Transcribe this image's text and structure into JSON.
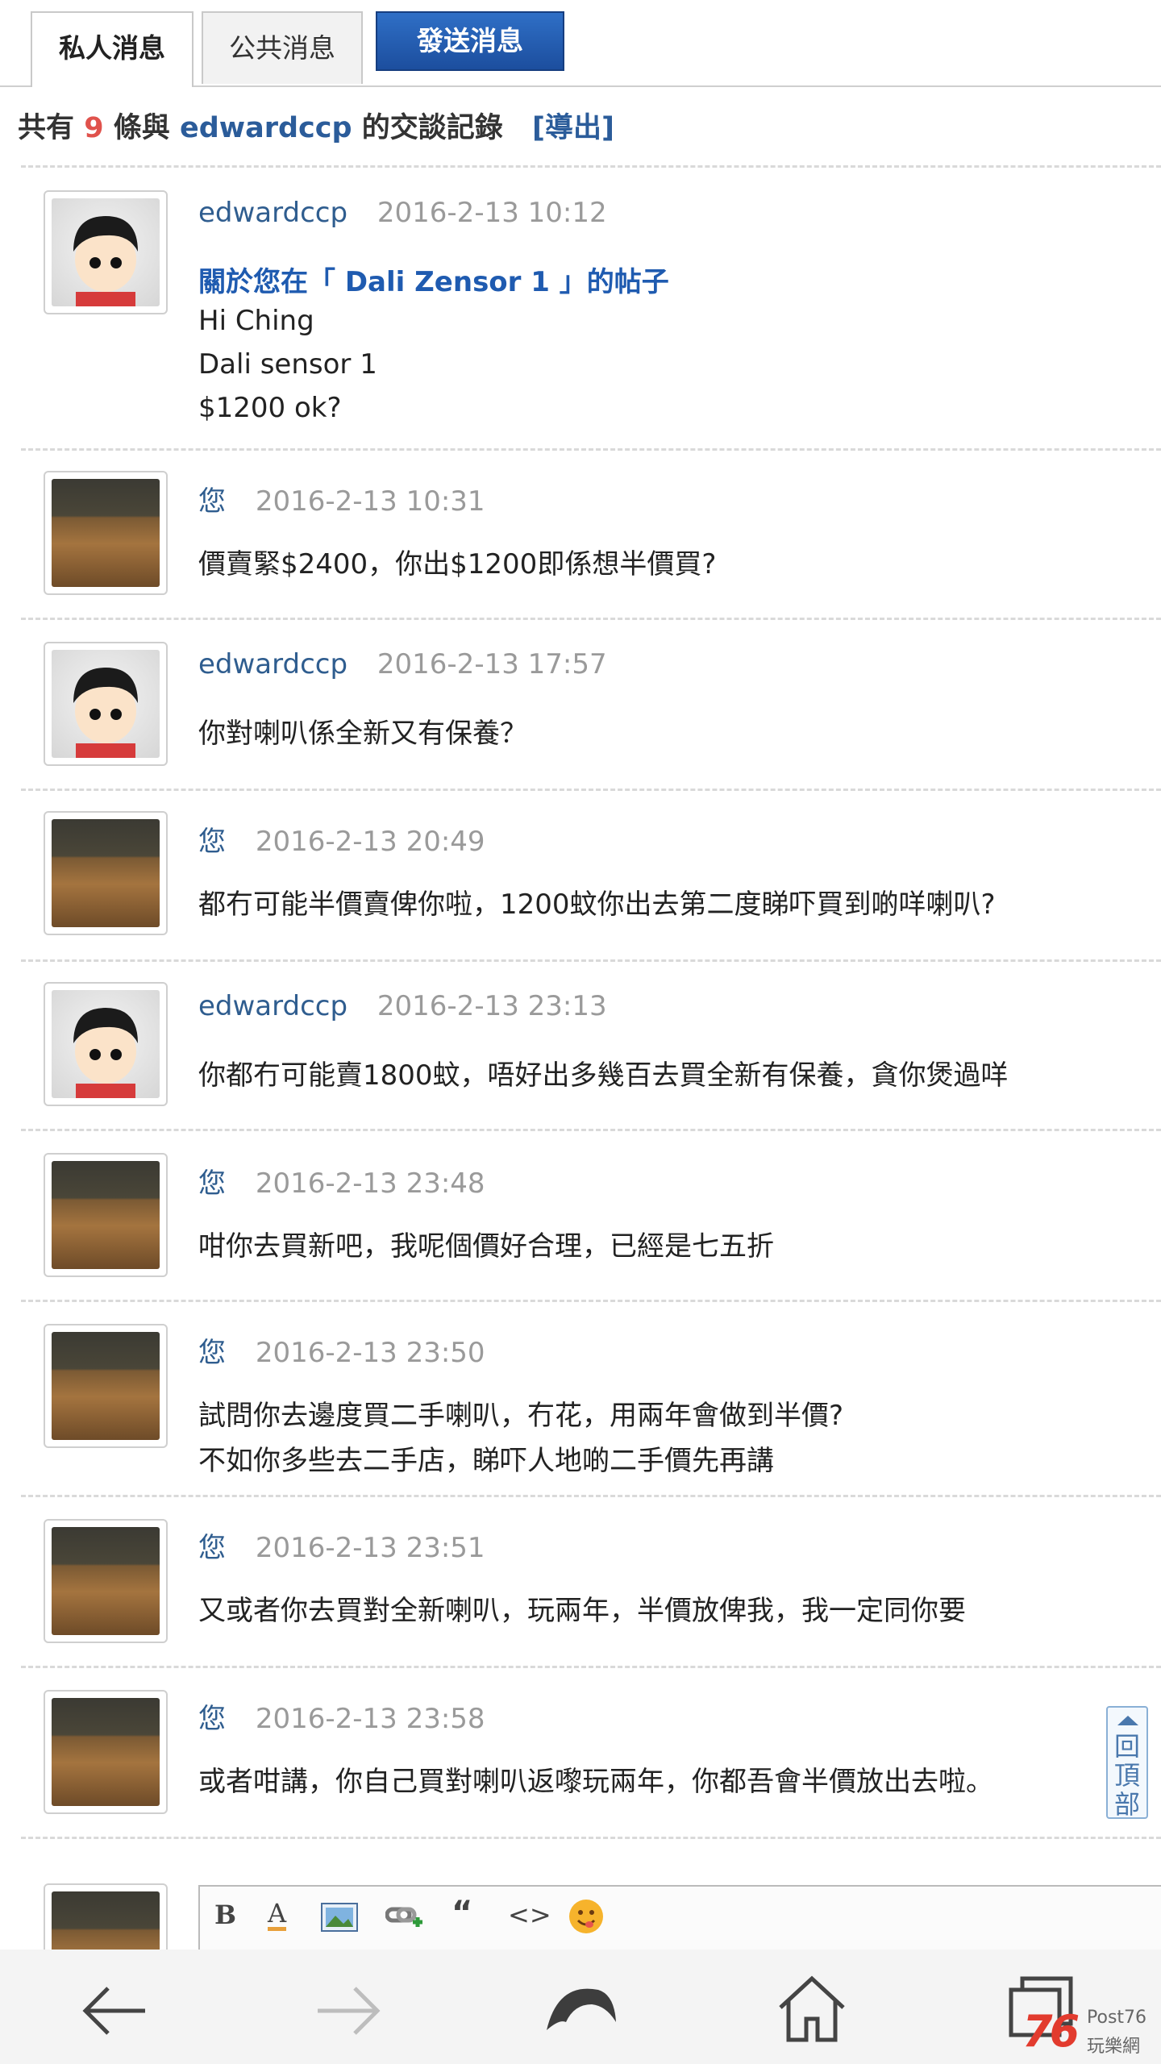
{
  "tabs": {
    "private": "私人消息",
    "public": "公共消息",
    "send": "發送消息"
  },
  "summary": {
    "prefix": "共有",
    "count": "9",
    "middle": "條與",
    "user": "edwardccp",
    "suffix": "的交談記錄",
    "export": "[導出]"
  },
  "messages": [
    {
      "sender": "edwardccp",
      "time": "2016-2-13 10:12",
      "subject": "關於您在「 Dali Zensor 1 」的帖子",
      "lines": [
        "Hi Ching",
        "Dali sensor 1",
        "$1200 ok?"
      ]
    },
    {
      "sender": "您",
      "time": "2016-2-13 10:31",
      "lines": [
        "價賣緊$2400，你出$1200即係想半價買?"
      ]
    },
    {
      "sender": "edwardccp",
      "time": "2016-2-13 17:57",
      "lines": [
        "你對喇叭係全新又有保養？"
      ]
    },
    {
      "sender": "您",
      "time": "2016-2-13 20:49",
      "lines": [
        "都冇可能半價賣俾你啦，1200蚊你出去第二度睇吓買到啲咩喇叭?"
      ]
    },
    {
      "sender": "edwardccp",
      "time": "2016-2-13 23:13",
      "lines": [
        "你都冇可能賣1800蚊，唔好出多幾百去買全新有保養，貪你煲過咩"
      ]
    },
    {
      "sender": "您",
      "time": "2016-2-13 23:48",
      "lines": [
        "咁你去買新吧，我呢個價好合理，已經是七五折"
      ]
    },
    {
      "sender": "您",
      "time": "2016-2-13 23:50",
      "lines": [
        "試問你去邊度買二手喇叭，冇花，用兩年會做到半價?",
        "不如你多些去二手店，睇吓人地啲二手價先再講"
      ]
    },
    {
      "sender": "您",
      "time": "2016-2-13 23:51",
      "lines": [
        "又或者你去買對全新喇叭，玩兩年，半價放俾我，我一定同你要"
      ]
    },
    {
      "sender": "您",
      "time": "2016-2-13 23:58",
      "lines": [
        "或者咁講，你自己買對喇叭返嚟玩兩年，你都吾會半價放出去啦。"
      ]
    }
  ],
  "editor": {
    "bold": "B",
    "font_color": "A",
    "quote": "“",
    "code": "<>"
  },
  "back_to_top": "回頂部",
  "logo": {
    "brand": "Post76",
    "number": "76",
    "cn": "玩樂網"
  },
  "icons": [
    "back-arrow-icon",
    "forward-arrow-icon",
    "dolphin-icon",
    "home-icon",
    "tabs-icon"
  ],
  "colors": {
    "link": "#2f5d8f",
    "count": "#e0524c",
    "send_button": "#1c4e9e",
    "timestamp": "#9a9a9a"
  }
}
